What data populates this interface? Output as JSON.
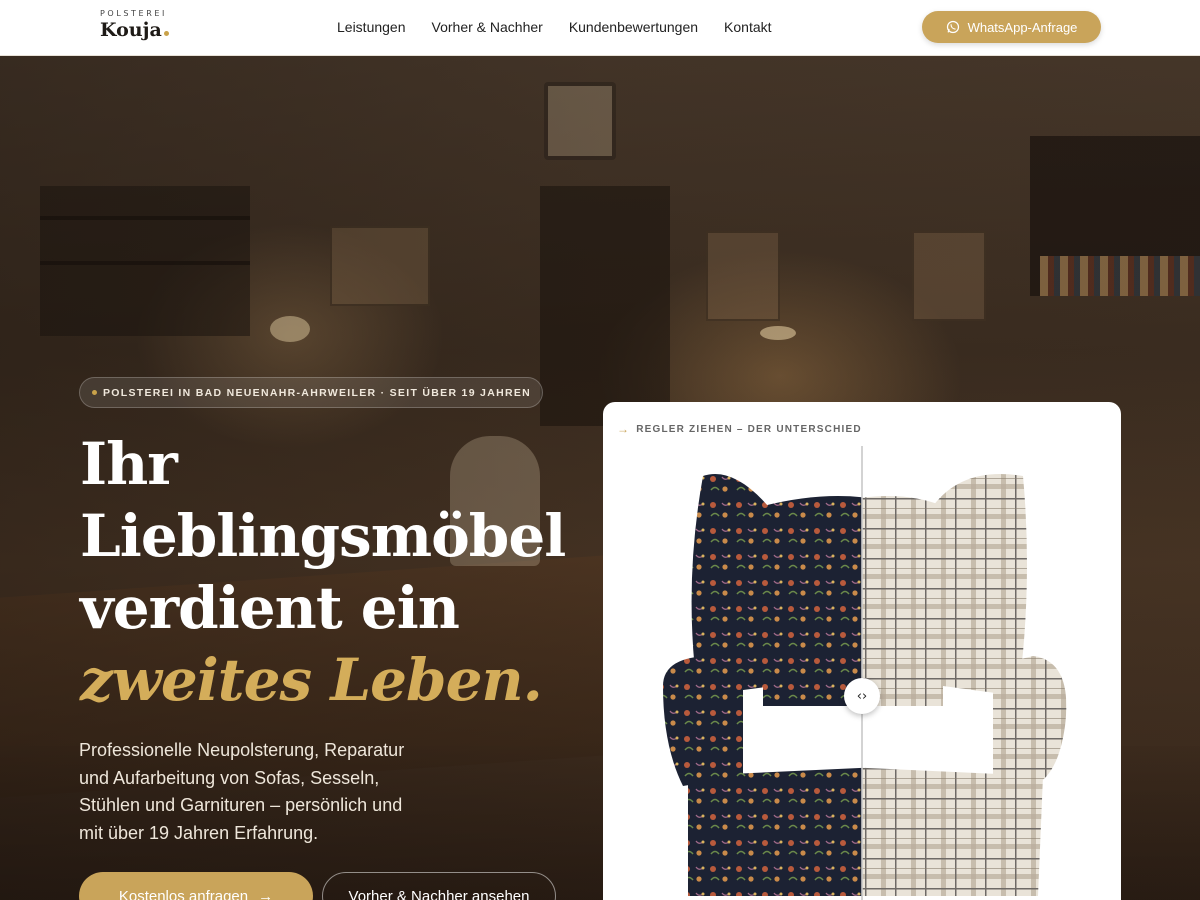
{
  "header": {
    "logo_small": "POLSTEREI",
    "logo_big": "Kouja",
    "nav": [
      {
        "label": "Leistungen"
      },
      {
        "label": "Vorher & Nachher"
      },
      {
        "label": "Kundenbewertungen"
      },
      {
        "label": "Kontakt"
      }
    ],
    "cta_label": "WhatsApp-Anfrage",
    "cta_icon": "whatsapp-icon"
  },
  "hero": {
    "badge": "POLSTEREI IN BAD NEUENAHR-AHRWEILER · SEIT ÜBER 19 JAHREN",
    "headline": {
      "line1": "Ihr",
      "line2": "Lieblingsmöbel",
      "line3": "verdient ein",
      "accent": "zweites Leben."
    },
    "subtext": "Professionelle Neupolsterung, Reparatur und Aufarbeitung von Sofas, Sesseln, Stühlen und Garnituren – persönlich und mit über 19 Jahren Erfahrung.",
    "primary_button": "Kostenlos anfragen",
    "secondary_button": "Vorher & Nachher ansehen"
  },
  "comparison": {
    "label": "REGLER ZIEHEN – DER UNTERSCHIED",
    "handle_glyph": "‹›",
    "slider_position": 0.5
  },
  "colors": {
    "accent": "#c9a45a",
    "accent_text": "#d4ad5a",
    "header_bg": "#ffffff",
    "text_dark": "#1e1a16"
  }
}
